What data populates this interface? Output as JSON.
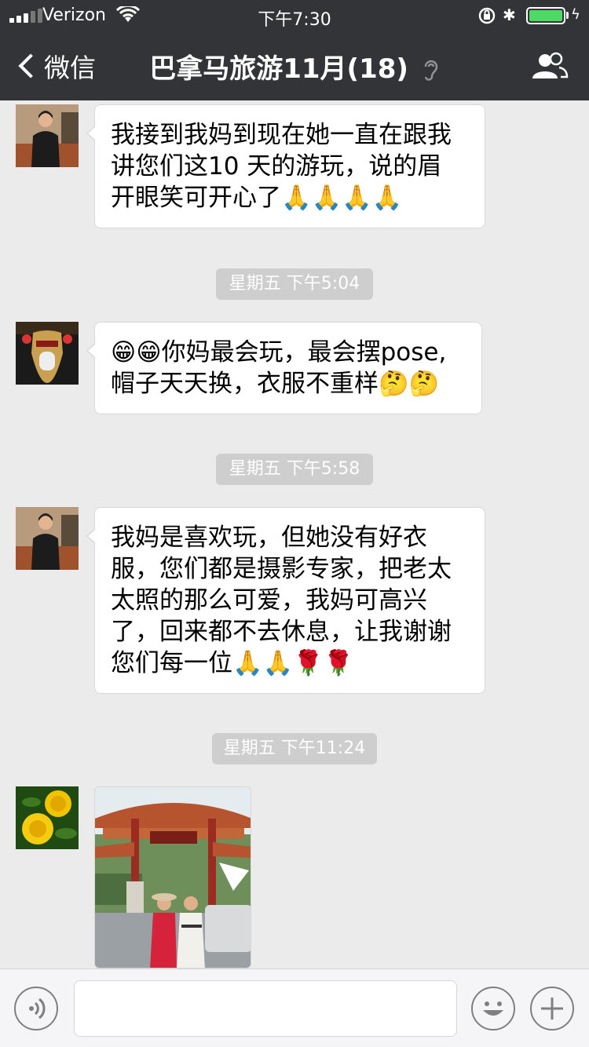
{
  "status_bar": {
    "carrier": "Verizon",
    "time": "下午7:30",
    "battery_color": "#4cd964"
  },
  "nav": {
    "back_label": "微信",
    "title": "巴拿马旅游11月(18)",
    "icons": [
      "back-chevron-icon",
      "mute-ear-icon",
      "group-members-icon"
    ]
  },
  "messages": [
    {
      "type": "text",
      "avatar": "woman-dark-jacket",
      "lines": [
        "我接到我妈到现在她一直在跟我",
        "讲您们这10 天的游玩，说的眉",
        "开眼笑可开心了🙏🙏🙏🙏"
      ]
    },
    {
      "type": "timestamp",
      "text": "星期五 下午5:04"
    },
    {
      "type": "text",
      "avatar": "panama-hat-sign",
      "lines": [
        "😁😁你妈最会玩，最会摆pose,",
        "帽子天天换，衣服不重样🤔🤔"
      ]
    },
    {
      "type": "timestamp",
      "text": "星期五 下午5:58"
    },
    {
      "type": "text",
      "avatar": "woman-dark-jacket",
      "lines": [
        "我妈是喜欢玩，但她没有好衣",
        "服，您们都是摄影专家，把老太",
        "太照的那么可爱，我妈可高兴",
        "了，回来都不去休息，让我谢谢",
        "您们每一位🙏🙏🌹🌹"
      ]
    },
    {
      "type": "timestamp",
      "text": "星期五 下午11:24"
    },
    {
      "type": "image",
      "avatar": "yellow-flowers",
      "image": "two-women-at-chinese-gate"
    }
  ],
  "input_bar": {
    "value": "",
    "icons": [
      "voice-icon",
      "emoji-icon",
      "plus-icon"
    ]
  }
}
